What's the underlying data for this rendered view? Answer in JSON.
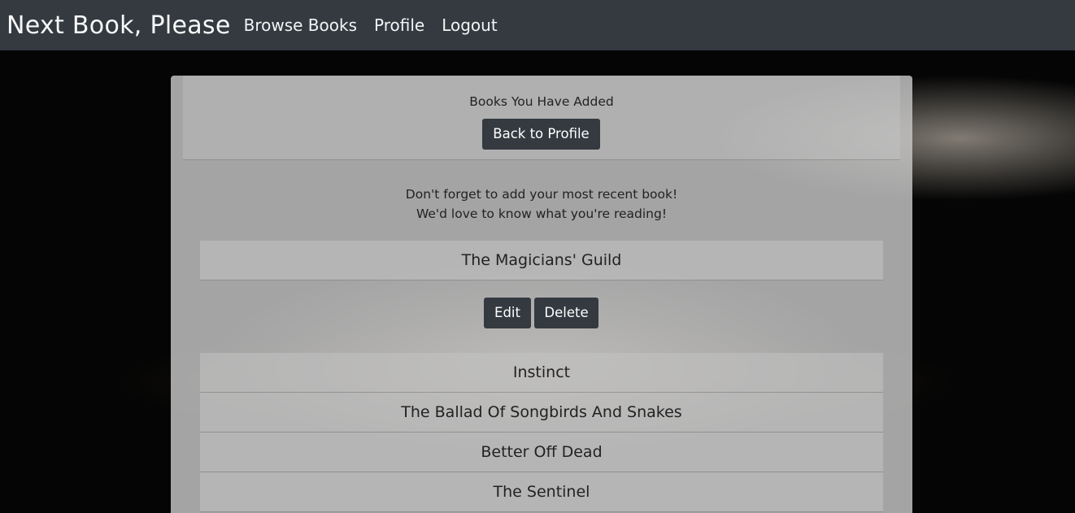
{
  "nav": {
    "brand": "Next Book, Please",
    "links": [
      "Browse Books",
      "Profile",
      "Logout"
    ]
  },
  "header": {
    "title": "Books You Have Added",
    "back_label": "Back to Profile"
  },
  "message": {
    "line1": "Don't forget to add your most recent book!",
    "line2": "We'd love to know what you're reading!"
  },
  "selected_book": {
    "title": "The Magicians' Guild",
    "edit_label": "Edit",
    "delete_label": "Delete"
  },
  "books": [
    "Instinct",
    "The Ballad Of Songbirds And Snakes",
    "Better Off Dead",
    "The Sentinel"
  ],
  "colors": {
    "navbar": "#343a40",
    "button": "#343a40"
  }
}
